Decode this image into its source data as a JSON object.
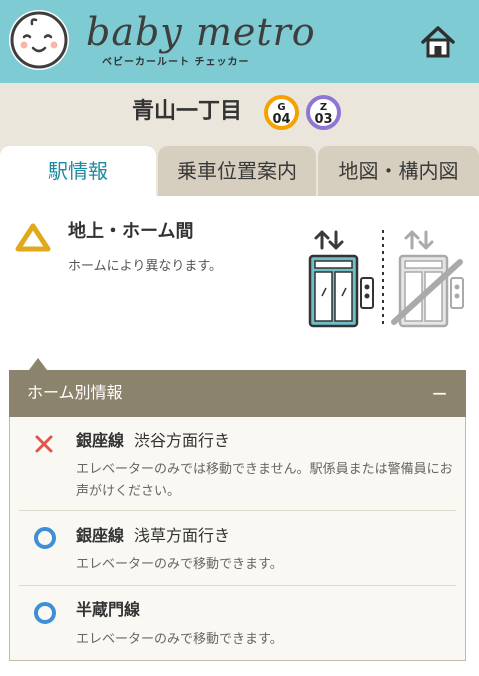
{
  "header": {
    "brand": "baby metro",
    "brand_sub": "ベビーカールート チェッカー"
  },
  "station": {
    "name": "青山一丁目",
    "badges": [
      {
        "line": "G",
        "number": "04",
        "color": "#f5a200"
      },
      {
        "line": "Z",
        "number": "03",
        "color": "#8f76d6"
      }
    ]
  },
  "tabs": [
    {
      "label": "駅情報",
      "active": true
    },
    {
      "label": "乗車位置案内",
      "active": false
    },
    {
      "label": "地図・構内図",
      "active": false
    }
  ],
  "access": {
    "title": "地上・ホーム間",
    "description": "ホームにより異なります。",
    "status_color": "#e0a81a"
  },
  "platform_panel": {
    "title": "ホーム別情報",
    "collapse": "−",
    "items": [
      {
        "line": "銀座線",
        "direction": "渋谷方面行き",
        "description": "エレベーターのみでは移動できません。駅係員または警備員にお声がけください。",
        "status": "x",
        "status_color": "#e0574f"
      },
      {
        "line": "銀座線",
        "direction": "浅草方面行き",
        "description": "エレベーターのみで移動できます。",
        "status": "circle",
        "status_color": "#3f8fd6"
      },
      {
        "line": "半蔵門線",
        "direction": "",
        "description": "エレベーターのみで移動できます。",
        "status": "circle",
        "status_color": "#3f8fd6"
      }
    ]
  },
  "colors": {
    "header_bg": "#7ecbd3",
    "accent": "#1d8aa0",
    "panel_head": "#8c836c"
  }
}
